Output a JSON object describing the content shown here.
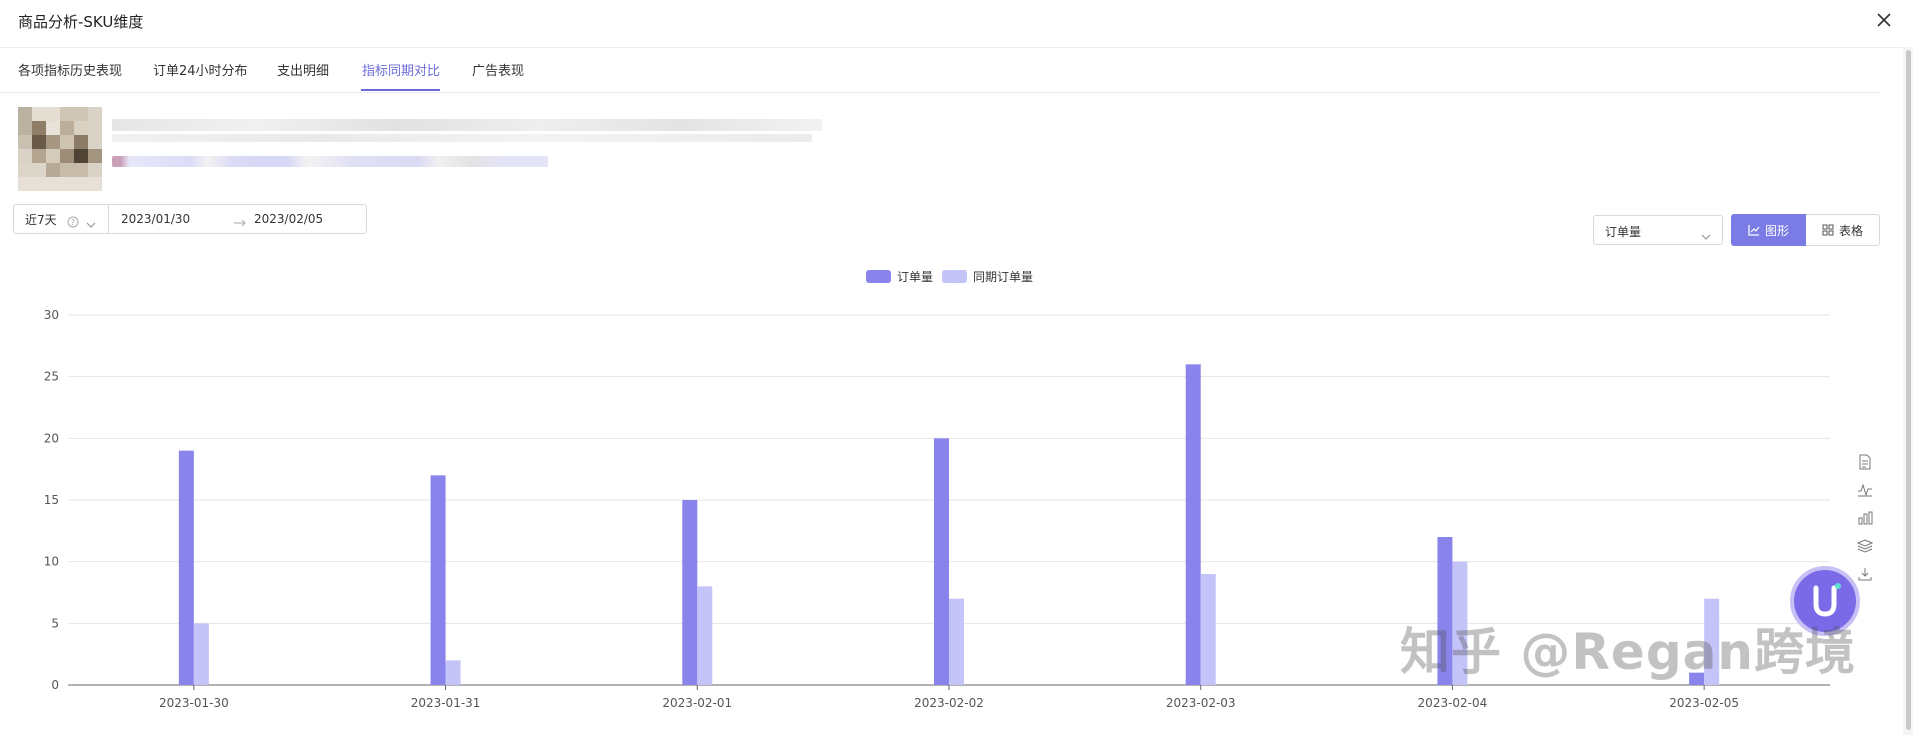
{
  "window": {
    "title": "商品分析-SKU维度"
  },
  "tabs": [
    {
      "label": "各项指标历史表现"
    },
    {
      "label": "订单24小时分布"
    },
    {
      "label": "支出明细"
    },
    {
      "label": "指标同期对比"
    },
    {
      "label": "广告表现"
    }
  ],
  "filters": {
    "preset": "近7天",
    "start_date": "2023/01/30",
    "end_date": "2023/02/05",
    "metric": "订单量"
  },
  "view_toggle": {
    "chart_label": "图形",
    "table_label": "表格"
  },
  "colors": {
    "accent": "#7b7be6",
    "current": "#8884ec",
    "previous": "#c5c4f8"
  },
  "watermark": "知乎 @Regan跨境",
  "chart_data": {
    "type": "bar",
    "categories": [
      "2023-01-30",
      "2023-01-31",
      "2023-02-01",
      "2023-02-02",
      "2023-02-03",
      "2023-02-04",
      "2023-02-05"
    ],
    "series": [
      {
        "name": "订单量",
        "values": [
          19,
          17,
          15,
          20,
          26,
          12,
          1
        ]
      },
      {
        "name": "同期订单量",
        "values": [
          5,
          2,
          8,
          7,
          9,
          10,
          7
        ]
      }
    ],
    "yticks": [
      0,
      5,
      10,
      15,
      20,
      25,
      30
    ],
    "ylim": [
      0,
      30
    ],
    "legend": "top-center",
    "grid": true
  }
}
